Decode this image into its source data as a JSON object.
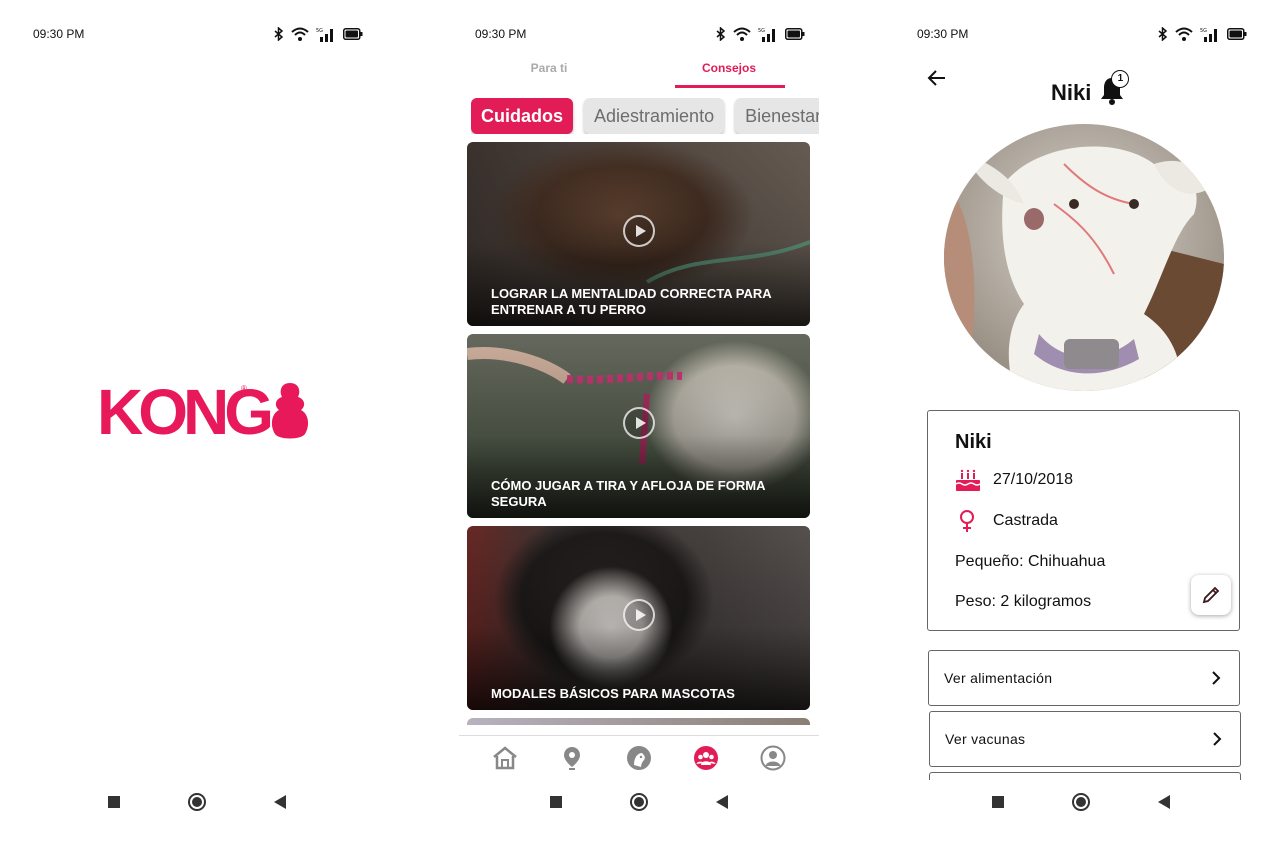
{
  "status_bar": {
    "time": "09:30 PM",
    "network_label": "5G"
  },
  "splash": {
    "brand": "KONG",
    "registered_mark": "®",
    "brand_color": "#e8195a"
  },
  "tips": {
    "top_tabs": [
      {
        "label": "Para ti",
        "active": false
      },
      {
        "label": "Consejos",
        "active": true
      }
    ],
    "chips": [
      {
        "label": "Cuidados",
        "active": true
      },
      {
        "label": "Adiestramiento",
        "active": false
      },
      {
        "label": "Bienestar",
        "active": false
      }
    ],
    "videos": [
      {
        "title": "LOGRAR LA MENTALIDAD CORRECTA PARA ENTRENAR A TU PERRO"
      },
      {
        "title": "CÓMO JUGAR A TIRA Y AFLOJA DE FORMA SEGURA"
      },
      {
        "title": "MODALES BÁSICOS PARA MASCOTAS"
      }
    ],
    "bottom_nav": [
      {
        "icon": "house-icon",
        "active": false
      },
      {
        "icon": "location-pin-icon",
        "active": false
      },
      {
        "icon": "dog-head-icon",
        "active": false
      },
      {
        "icon": "community-icon",
        "active": true
      },
      {
        "icon": "profile-icon",
        "active": false
      }
    ],
    "accent_color": "#e21c57"
  },
  "pet_profile": {
    "header_name": "Niki",
    "notification_count": "1",
    "card": {
      "name": "Niki",
      "birthdate": "27/10/2018",
      "sex_status": "Castrada",
      "breed": "Pequeño: Chihuahua",
      "weight": "Peso: 2 kilogramos"
    },
    "links": [
      {
        "label": "Ver alimentación"
      },
      {
        "label": "Ver vacunas"
      }
    ],
    "accent_color": "#e21c57"
  }
}
